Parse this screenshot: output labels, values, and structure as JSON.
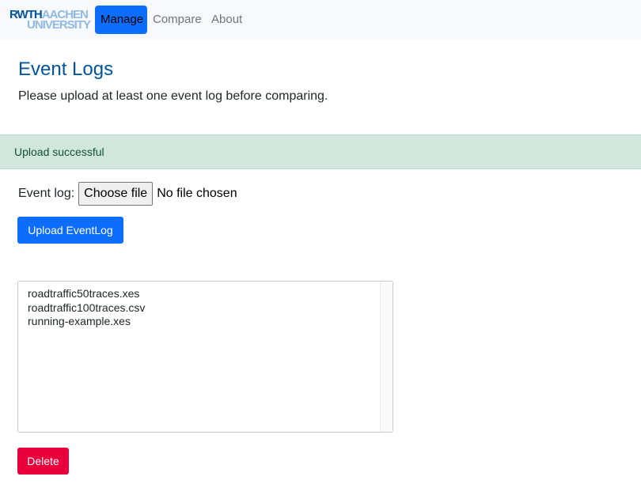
{
  "nav": {
    "logo": {
      "top_bold": "RWTH",
      "top_light": "AACHEN",
      "bottom": "UNIVERSITY"
    },
    "links": [
      "Manage",
      "Compare",
      "About"
    ],
    "active": "Manage"
  },
  "page": {
    "title": "Event Logs",
    "subtitle": "Please upload at least one event log before comparing."
  },
  "alert": {
    "message": "Upload successful",
    "type": "success"
  },
  "upload": {
    "label": "Event log:",
    "choose_button": "Choose file",
    "file_status": "No file chosen",
    "submit_label": "Upload EventLog"
  },
  "event_logs": [
    "roadtraffic50traces.xes",
    "roadtraffic100traces.csv",
    "running-example.xes"
  ],
  "delete_label": "Delete",
  "colors": {
    "brand_blue": "#00549f",
    "primary": "#0d6efd",
    "danger": "#e8003d",
    "success_bg": "#d1e7dd",
    "success_text": "#0f5132"
  }
}
